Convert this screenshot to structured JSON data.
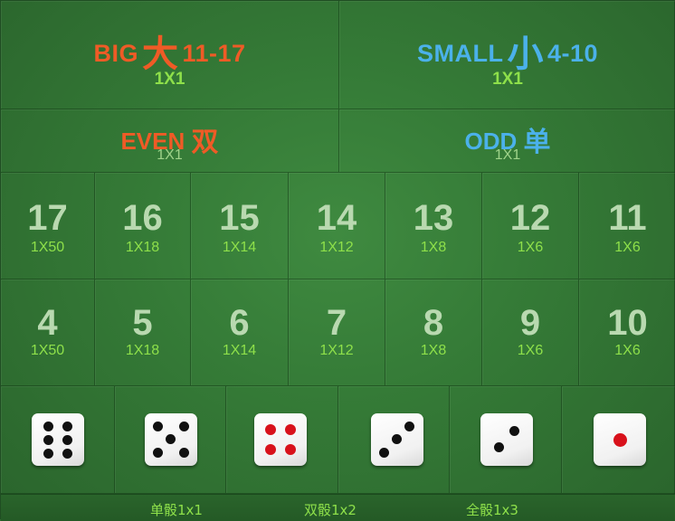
{
  "big": {
    "label": "BIG",
    "cjk": "大",
    "range": "11-17",
    "payout": "1X1",
    "color": "#ef5b26"
  },
  "small": {
    "label": "SMALL",
    "cjk": "小",
    "range": "4-10",
    "payout": "1X1",
    "color": "#4bb1ea"
  },
  "even": {
    "label": "EVEN",
    "cjk": "双",
    "payout": "1X1"
  },
  "odd": {
    "label": "ODD",
    "cjk": "单",
    "payout": "1X1"
  },
  "totals_high": [
    {
      "number": "17",
      "payout": "1X50"
    },
    {
      "number": "16",
      "payout": "1X18"
    },
    {
      "number": "15",
      "payout": "1X14"
    },
    {
      "number": "14",
      "payout": "1X12"
    },
    {
      "number": "13",
      "payout": "1X8"
    },
    {
      "number": "12",
      "payout": "1X6"
    },
    {
      "number": "11",
      "payout": "1X6"
    }
  ],
  "totals_low": [
    {
      "number": "4",
      "payout": "1X50"
    },
    {
      "number": "5",
      "payout": "1X18"
    },
    {
      "number": "6",
      "payout": "1X14"
    },
    {
      "number": "7",
      "payout": "1X12"
    },
    {
      "number": "8",
      "payout": "1X8"
    },
    {
      "number": "9",
      "payout": "1X6"
    },
    {
      "number": "10",
      "payout": "1X6"
    }
  ],
  "dice_faces": [
    6,
    5,
    4,
    3,
    2,
    1
  ],
  "footer": {
    "single": "单骰1x1",
    "double": "双骰1x2",
    "triple": "全骰1x3"
  }
}
